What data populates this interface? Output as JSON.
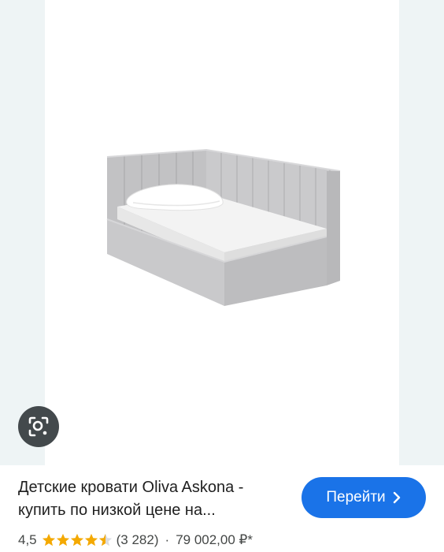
{
  "product": {
    "title": "Детские кровати Oliva Askona - купить по низкой цене на...",
    "rating": "4,5",
    "rating_value": 4.5,
    "reviews": "(3 282)",
    "separator": "·",
    "price": "79 002,00 ₽*"
  },
  "actions": {
    "go_label": "Перейти",
    "go_icon": "chevron-right-icon",
    "lens_icon": "lens-search-icon"
  },
  "colors": {
    "accent": "#1a73e8",
    "star": "#f4a902",
    "bed_fabric": "#c4c4c6",
    "mattress": "#f4f4f4"
  }
}
